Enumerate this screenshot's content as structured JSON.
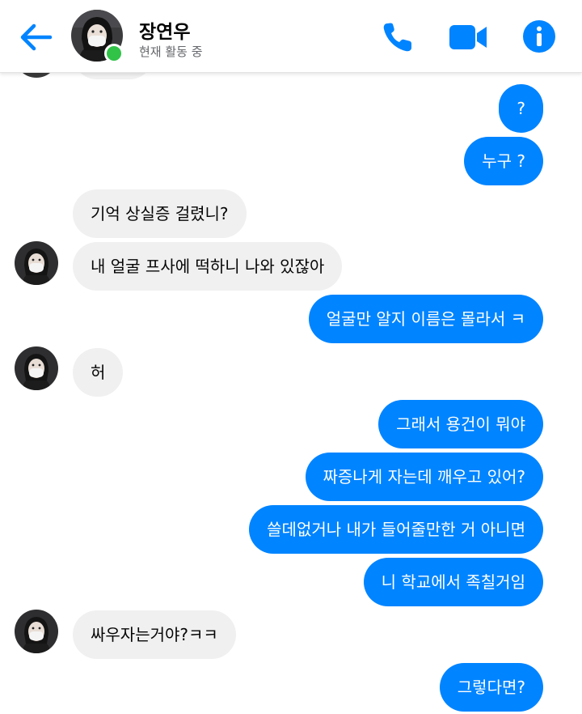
{
  "header": {
    "name": "장연우",
    "status": "현재 활동 중",
    "accent_color": "#0084ff",
    "online_color": "#31c248",
    "icons": [
      "back-arrow-icon",
      "phone-icon",
      "video-camera-icon",
      "info-icon"
    ]
  },
  "messages": [
    {
      "dir": "out",
      "text": "?"
    },
    {
      "dir": "out",
      "text": "누구 ?"
    },
    {
      "dir": "in",
      "text": "기억 상실증 걸렸니?"
    },
    {
      "dir": "in",
      "text": "내 얼굴 프사에 떡하니 나와 있잖아"
    },
    {
      "dir": "out",
      "text": "얼굴만 알지 이름은 몰라서 ㅋ"
    },
    {
      "dir": "in",
      "text": "허"
    },
    {
      "dir": "out",
      "text": "그래서 용건이 뭐야"
    },
    {
      "dir": "out",
      "text": "짜증나게 자는데 깨우고 있어?"
    },
    {
      "dir": "out",
      "text": "쓸데없거나 내가 들어줄만한 거 아니면"
    },
    {
      "dir": "out",
      "text": "니 학교에서 족칠거임"
    },
    {
      "dir": "in",
      "text": "싸우자는거야?ㅋㅋ"
    },
    {
      "dir": "out",
      "text": "그렇다면?"
    }
  ]
}
